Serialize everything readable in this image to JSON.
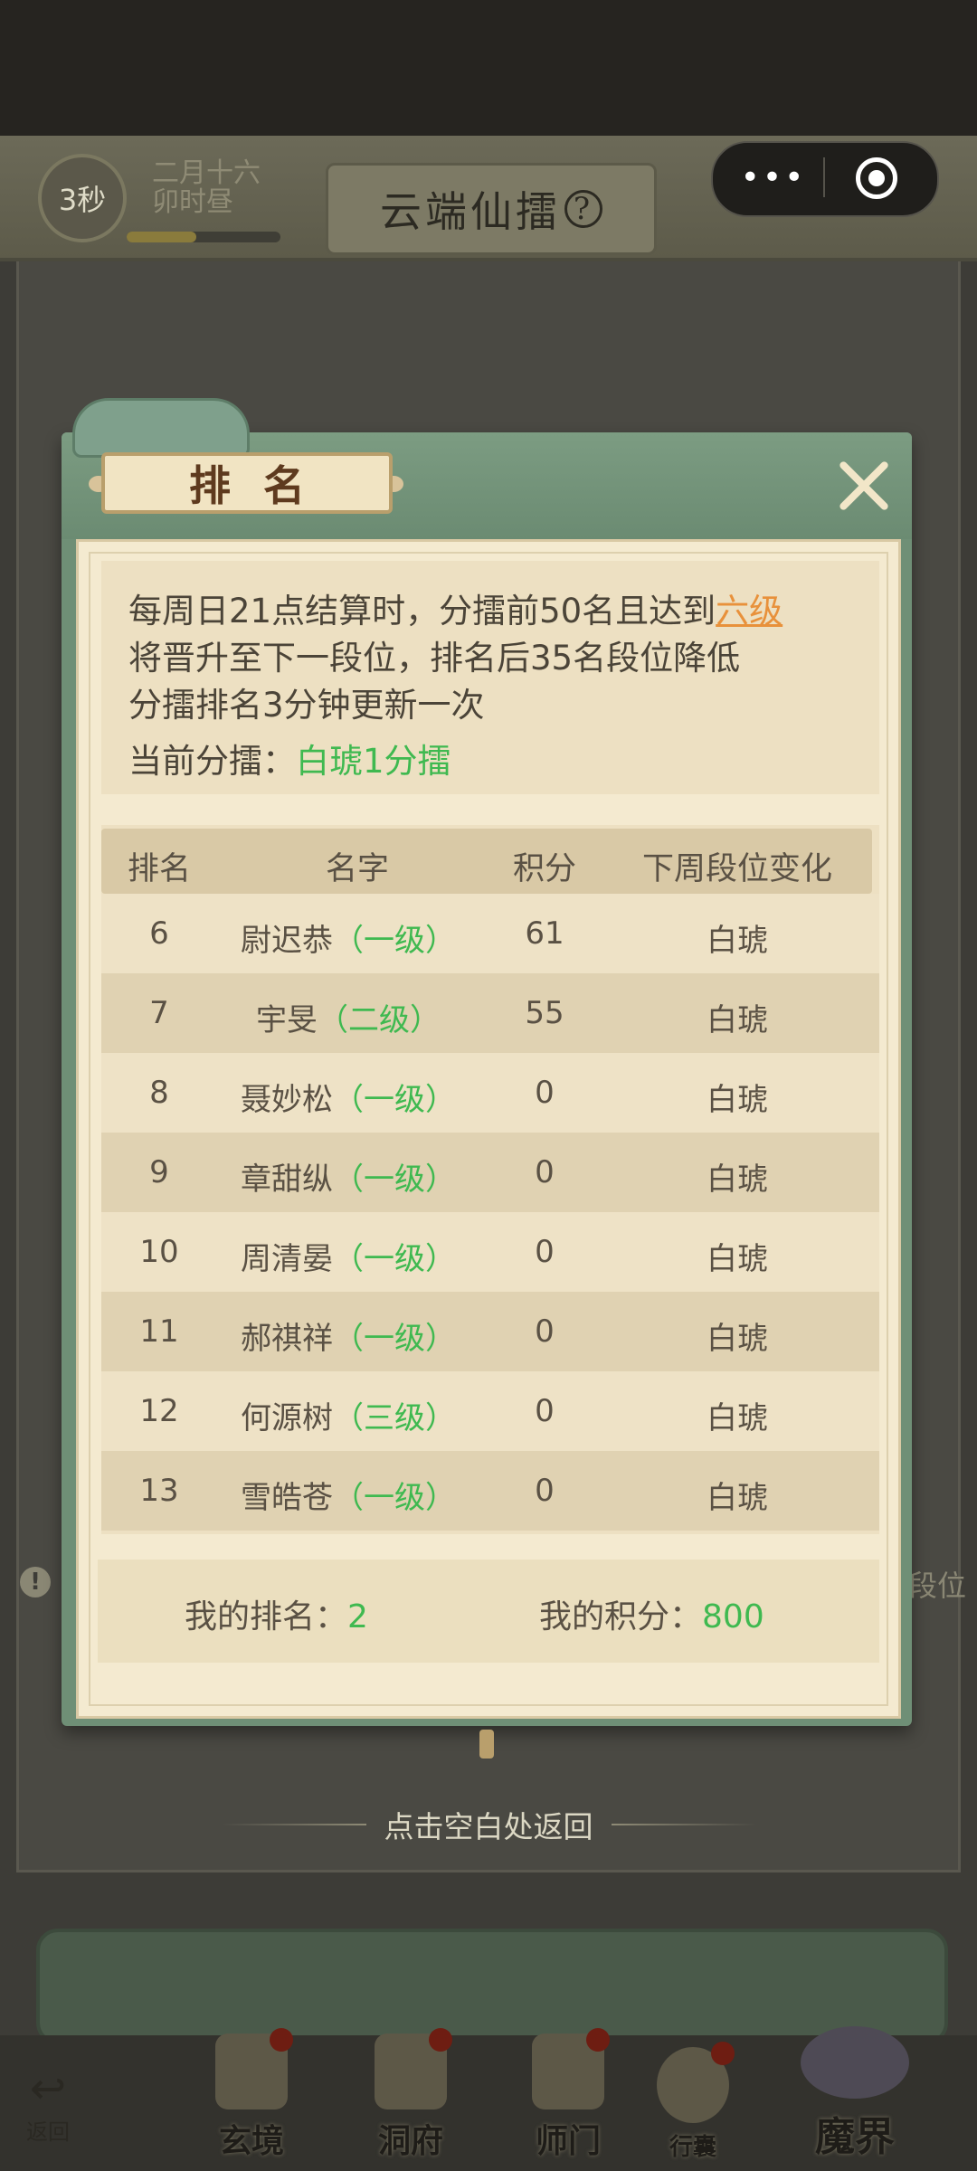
{
  "header": {
    "timer": "3秒",
    "date_line1": "二月十六",
    "date_line2": "卯时昼",
    "title": "云端仙擂",
    "help_glyph": "?",
    "progress_fraction": 0.45
  },
  "capsule": {
    "more_label": "•••"
  },
  "background": {
    "side_text": "段位",
    "warn_glyph": "!"
  },
  "modal": {
    "title": "排名",
    "info": {
      "line1_prefix": "每周日21点结算时，分擂前50名且达到",
      "line1_link": "六级",
      "line2": "将晋升至下一段位，排名后35名段位降低",
      "line3": "分擂排名3分钟更新一次",
      "current_label": "当前分擂：",
      "current_value": "白琥1分擂"
    },
    "columns": [
      "排名",
      "名字",
      "积分",
      "下周段位变化"
    ],
    "rows": [
      {
        "rank": "6",
        "name": "尉迟恭",
        "level": "（一级）",
        "score": "61",
        "change": "白琥"
      },
      {
        "rank": "7",
        "name": "宇旻",
        "level": "（二级）",
        "score": "55",
        "change": "白琥"
      },
      {
        "rank": "8",
        "name": "聂妙松",
        "level": "（一级）",
        "score": "0",
        "change": "白琥"
      },
      {
        "rank": "9",
        "name": "章甜纵",
        "level": "（一级）",
        "score": "0",
        "change": "白琥"
      },
      {
        "rank": "10",
        "name": "周清晏",
        "level": "（一级）",
        "score": "0",
        "change": "白琥"
      },
      {
        "rank": "11",
        "name": "郝祺祥",
        "level": "（一级）",
        "score": "0",
        "change": "白琥"
      },
      {
        "rank": "12",
        "name": "何源树",
        "level": "（三级）",
        "score": "0",
        "change": "白琥"
      },
      {
        "rank": "13",
        "name": "雪皓苍",
        "level": "（一级）",
        "score": "0",
        "change": "白琥"
      }
    ],
    "my_rank_label": "我的排名：",
    "my_rank_value": "2",
    "my_score_label": "我的积分：",
    "my_score_value": "800"
  },
  "hint": "点击空白处返回",
  "nav": {
    "back_glyph": "↩",
    "back_label": "返回",
    "items": [
      {
        "label": "玄境"
      },
      {
        "label": "洞府"
      },
      {
        "label": "师门"
      },
      {
        "label": "行囊"
      },
      {
        "label": "魔界"
      }
    ]
  }
}
